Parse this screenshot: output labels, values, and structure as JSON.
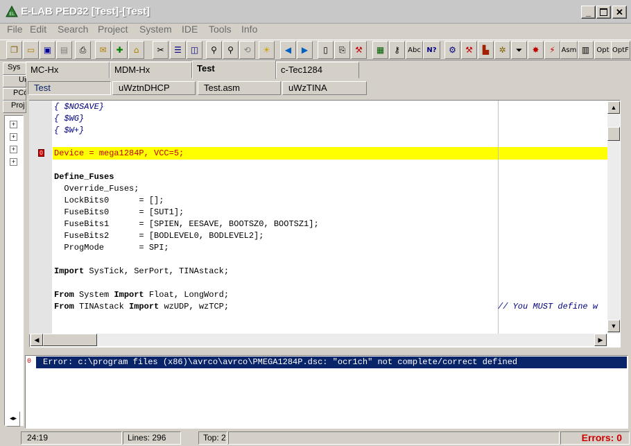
{
  "window": {
    "title": "E-LAB PED32 [Test]-[Test]"
  },
  "menu": [
    "File",
    "Edit",
    "Search",
    "Project",
    "System",
    "IDE",
    "Tools",
    "Info"
  ],
  "toolbar_text": {
    "abc": "Abc",
    "help": "N?",
    "asm": "Asm",
    "opt": "Opt",
    "optf": "OptF"
  },
  "left_tabs": [
    "Sys",
    "Ui",
    "PCo",
    "Proj"
  ],
  "project_tabs": [
    "MC-Hx",
    "MDM-Hx",
    "Test",
    "c-Tec1284"
  ],
  "file_tabs": [
    "Test",
    "uWztnDHCP",
    "Test.asm",
    "uWzTINA"
  ],
  "code": {
    "line1": "{ $NOSAVE}",
    "line2": "{ $WG}",
    "line3": "{ $W+}",
    "line5": "Device = mega1284P, VCC=5;",
    "line7": "Define_Fuses",
    "line8": "  Override_Fuses;",
    "line9": "  LockBits0      = [];",
    "line10": "  FuseBits0      = [SUT1];",
    "line11": "  FuseBits1      = [SPIEN, EESAVE, BOOTSZ0, BOOTSZ1];",
    "line12": "  FuseBits2      = [BODLEVEL0, BODLEVEL2];",
    "line13": "  ProgMode       = SPI;",
    "line15_kw": "Import",
    "line15_rest": " SysTick, SerPort, TINAstack;",
    "line17_kw1": "From",
    "line17_mid": " System ",
    "line17_kw2": "Import",
    "line17_rest": " Float, LongWord;",
    "line18_kw1": "From",
    "line18_mid": " TINAstack ",
    "line18_kw2": "Import",
    "line18_rest": " wzUDP, wzTCP;",
    "line18_comment": "// You MUST define w"
  },
  "messages": {
    "error_marker": "0",
    "error_text": "Error: c:\\program files (x86)\\avrco\\avrco\\PMEGA1284P.dsc: \"ocr1ch\" not complete/correct defined"
  },
  "status": {
    "position": "24:19",
    "lines": "Lines: 296",
    "top": "Top: 2",
    "errors": "Errors: 0"
  },
  "colors": {
    "highlight": "#ffff00",
    "error_bar": "#0a246a",
    "errors_text": "#cc0000"
  }
}
